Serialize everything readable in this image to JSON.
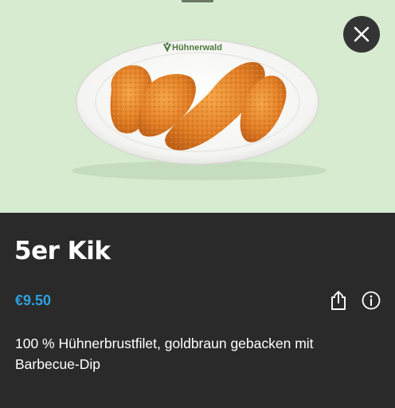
{
  "product": {
    "brand_logo_text": "Hühnerwald",
    "title": "5er Kik",
    "price": "€9.50",
    "description": "100 % Hühnerbrustfilet, goldbraun gebacken mit Barbecue-Dip"
  },
  "icons": {
    "close": "close-icon",
    "share": "share-icon",
    "info": "info-icon"
  },
  "colors": {
    "hero_background": "#d6ebcf",
    "sheet_background": "#2a2a2a",
    "price": "#2e9fe0",
    "close_button": "#343434"
  }
}
